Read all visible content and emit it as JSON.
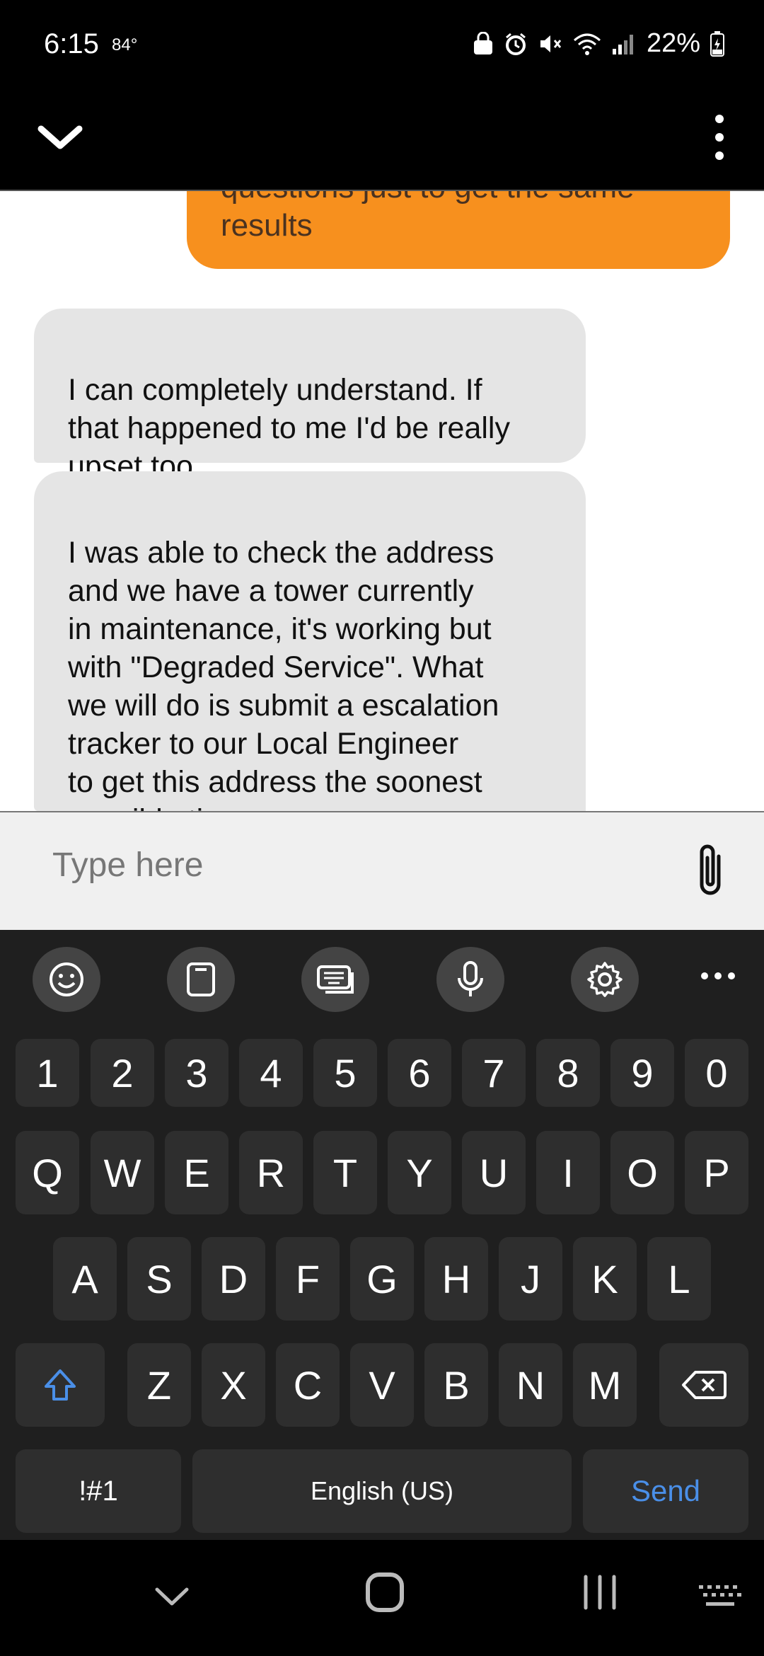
{
  "status_bar": {
    "time": "6:15",
    "temperature": "84°",
    "battery": "22%"
  },
  "chat": {
    "messages": [
      {
        "from": "user",
        "text": "questions just to get the same\nresults"
      },
      {
        "from": "agent",
        "text": "I can completely understand. If\nthat happened to me I'd be really\nupset too."
      },
      {
        "from": "agent",
        "text": "I was able to check the address\nand we have a tower currently\nin maintenance, it's working but\nwith \"Degraded Service\". What\nwe will do is submit a escalation\ntracker to our Local Engineer\nto get this address the soonest\npossible time."
      }
    ]
  },
  "composer": {
    "placeholder": "Type here"
  },
  "keyboard": {
    "numbers": [
      "1",
      "2",
      "3",
      "4",
      "5",
      "6",
      "7",
      "8",
      "9",
      "0"
    ],
    "row1": [
      "Q",
      "W",
      "E",
      "R",
      "T",
      "Y",
      "U",
      "I",
      "O",
      "P"
    ],
    "row2": [
      "A",
      "S",
      "D",
      "F",
      "G",
      "H",
      "J",
      "K",
      "L"
    ],
    "row3": [
      "Z",
      "X",
      "C",
      "V",
      "B",
      "N",
      "M"
    ],
    "symbols_key": "!#1",
    "space_label": "English (US)",
    "send_label": "Send"
  },
  "colors": {
    "outgoing_bubble": "#f7901e",
    "incoming_bubble": "#e5e5e5",
    "send_accent": "#4a8fe8"
  }
}
